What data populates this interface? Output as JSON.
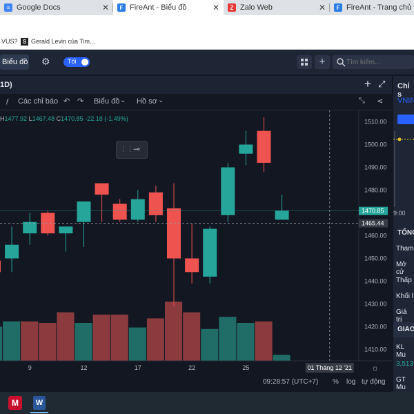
{
  "browser": {
    "tabs": [
      {
        "label": "Google Docs",
        "icon": "docs-icon",
        "color": "#4285f4",
        "active": false
      },
      {
        "label": "FireAnt - Biểu đồ",
        "icon": "fireant-icon",
        "color": "#2a7de1",
        "active": true
      },
      {
        "label": "Zalo Web",
        "icon": "zalo-icon",
        "color": "#e53935",
        "active": false
      },
      {
        "label": "FireAnt - Trang chủ",
        "icon": "fireant-icon",
        "color": "#2a7de1",
        "active": false
      }
    ],
    "bookmarks": [
      {
        "label": "VUS?"
      },
      {
        "label": "Gerald Levin của Tim..."
      }
    ]
  },
  "app": {
    "chart_label": "Biểu đồ",
    "theme_toggle_label": "Tối",
    "search_placeholder": "Tìm kiếm..."
  },
  "chart_window": {
    "interval_label": "1D)",
    "toolbar": {
      "indicators_label": "Các chỉ báo",
      "chart_menu_label": "Biểu đồ",
      "profile_menu_label": "Hồ sơ"
    },
    "ohlc": {
      "h_label": "H",
      "h": "1477.92",
      "l_label": "L",
      "l": "1467.48",
      "c_label": "C",
      "c": "1470.85",
      "change": "-22.18 (-1.49%)"
    },
    "last_price_label": "1470.85",
    "crosshair_price_label": "1465.44",
    "crosshair_date_label": "01 Tháng 12 '21",
    "time_label": "09:28:57 (UTC+7)",
    "bottom_controls": {
      "percent": "%",
      "log": "log",
      "auto": "tự động"
    }
  },
  "right_panel": {
    "title": "Chỉ s",
    "symbol": "VNIN",
    "time_tick": "9:00",
    "section": "TỔNG",
    "rows": [
      "Tham",
      "Mở cử",
      "Thấp",
      "Khối l",
      "Giá trị"
    ],
    "section2": "GIAO",
    "kl_label": "KL Mu",
    "kl_value": "3,513",
    "gt_label": "GT Mu"
  },
  "chart_data": {
    "type": "candlestick",
    "colors": {
      "up": "#26a69a",
      "down": "#ef5350",
      "up_volume": "#1f6d66",
      "down_volume": "#8b3a3e",
      "background": "#131722"
    },
    "y_axis_ticks": [
      1410,
      1420,
      1430,
      1440,
      1450,
      1460,
      1470,
      1480,
      1490,
      1500,
      1510
    ],
    "x_axis_ticks": [
      {
        "label": "9",
        "index": 2
      },
      {
        "label": "12",
        "index": 5
      },
      {
        "label": "17",
        "index": 8
      },
      {
        "label": "22",
        "index": 11
      },
      {
        "label": "25",
        "index": 14
      }
    ],
    "candles": [
      {
        "o": 1449,
        "h": 1453,
        "l": 1440,
        "c": 1444
      },
      {
        "o": 1450,
        "h": 1464,
        "l": 1444,
        "c": 1456
      },
      {
        "o": 1461,
        "h": 1470,
        "l": 1456,
        "c": 1466
      },
      {
        "o": 1470,
        "h": 1471,
        "l": 1460,
        "c": 1461
      },
      {
        "o": 1461,
        "h": 1463,
        "l": 1453,
        "c": 1464
      },
      {
        "o": 1466,
        "h": 1475,
        "l": 1455,
        "c": 1475
      },
      {
        "o": 1483,
        "h": 1483,
        "l": 1466,
        "c": 1478
      },
      {
        "o": 1474,
        "h": 1476,
        "l": 1466,
        "c": 1467
      },
      {
        "o": 1467,
        "h": 1480,
        "l": 1466,
        "c": 1476
      },
      {
        "o": 1479,
        "h": 1482,
        "l": 1466,
        "c": 1469
      },
      {
        "o": 1472,
        "h": 1483,
        "l": 1429,
        "c": 1450
      },
      {
        "o": 1450,
        "h": 1465,
        "l": 1439,
        "c": 1444
      },
      {
        "o": 1442,
        "h": 1464,
        "l": 1439,
        "c": 1463
      },
      {
        "o": 1469,
        "h": 1492,
        "l": 1466,
        "c": 1490
      },
      {
        "o": 1496,
        "h": 1506,
        "l": 1491,
        "c": 1500
      },
      {
        "o": 1506,
        "h": 1512,
        "l": 1488,
        "c": 1492
      },
      {
        "o": 1467,
        "h": 1478,
        "l": 1467,
        "c": 1471
      }
    ],
    "volume_direction": [
      "up",
      "up",
      "down",
      "down",
      "down",
      "up",
      "down",
      "down",
      "up",
      "down",
      "down",
      "down",
      "up",
      "up",
      "up",
      "down",
      "up"
    ],
    "volume": [
      0.45,
      0.52,
      0.52,
      0.5,
      0.64,
      0.5,
      0.61,
      0.61,
      0.44,
      0.56,
      0.78,
      0.64,
      0.42,
      0.58,
      0.5,
      0.52,
      0.08
    ]
  }
}
